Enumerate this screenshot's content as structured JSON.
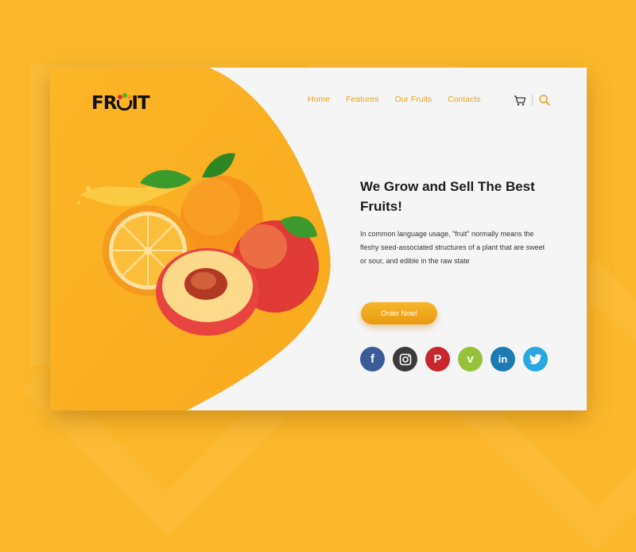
{
  "logo": {
    "text_before": "FR",
    "text_after": "IT"
  },
  "nav": {
    "items": [
      "Home",
      "Features",
      "Our Fruits",
      "Contacts"
    ]
  },
  "icons": {
    "cart": "cart-icon",
    "search": "search-icon"
  },
  "hero": {
    "title": "We Grow and Sell The Best Fruits!",
    "description": "In common language usage, \"fruit\" normally means the fleshy seed-associated structures of a plant that are sweet or sour, and edible in the raw state"
  },
  "cta": {
    "label": "Order Now!"
  },
  "social": {
    "facebook": "f",
    "instagram": "instagram-icon",
    "pinterest": "P",
    "vimeo": "v",
    "linkedin": "in",
    "twitter": "twitter-icon"
  },
  "colors": {
    "accent": "#fcb82a",
    "nav_text": "#e8a31b",
    "facebook": "#3b5a9a",
    "instagram": "#3a3a3a",
    "pinterest": "#c9252c",
    "vimeo": "#97c13a",
    "linkedin": "#1b7ab0",
    "twitter": "#2aa7e0"
  }
}
